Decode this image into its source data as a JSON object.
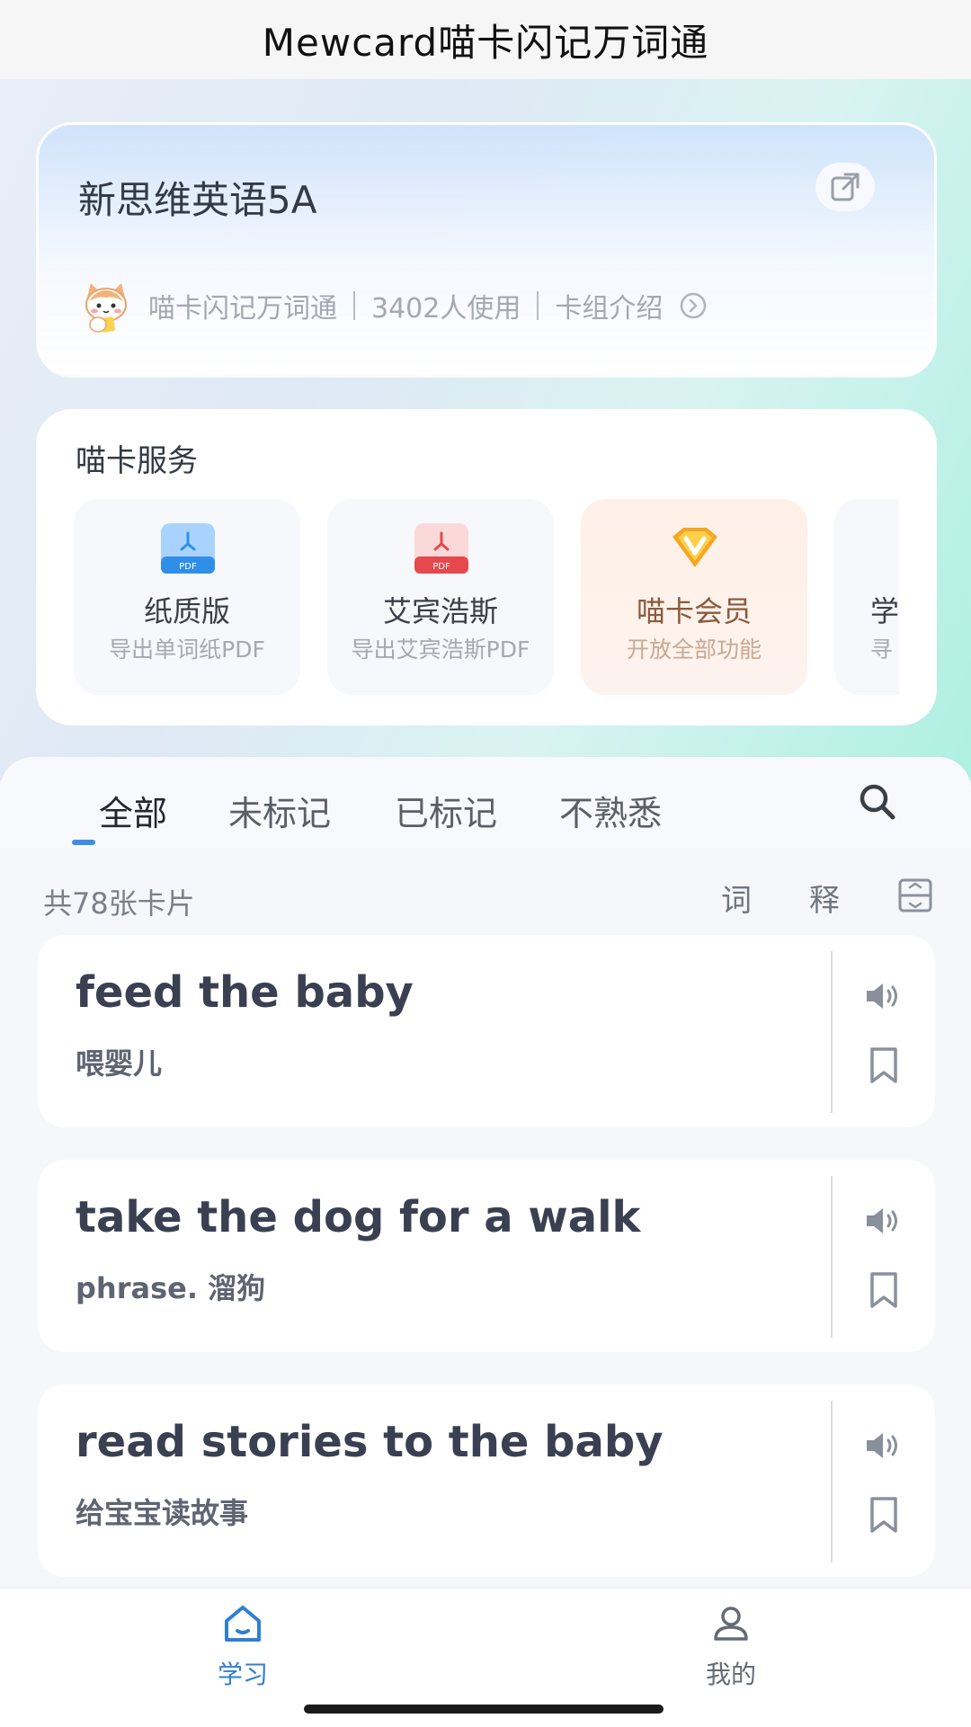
{
  "app_title": "Mewcard喵卡闪记万词通",
  "deck": {
    "title": "新思维英语5A",
    "source": "喵卡闪记万词通",
    "users": "3402人使用",
    "intro": "卡组介绍"
  },
  "services": {
    "title": "喵卡服务",
    "items": [
      {
        "title": "纸质版",
        "subtitle": "导出单词纸PDF",
        "icon": "pdf-blue-icon"
      },
      {
        "title": "艾宾浩斯",
        "subtitle": "导出艾宾浩斯PDF",
        "icon": "pdf-red-icon"
      },
      {
        "title": "喵卡会员",
        "subtitle": "开放全部功能",
        "icon": "vip-icon"
      },
      {
        "title": "学",
        "subtitle": "寻"
      }
    ]
  },
  "tabs": [
    {
      "label": "全部",
      "active": true
    },
    {
      "label": "未标记",
      "active": false
    },
    {
      "label": "已标记",
      "active": false
    },
    {
      "label": "不熟悉",
      "active": false
    }
  ],
  "list": {
    "count": "共78张卡片",
    "view_word": "词",
    "view_meaning": "释",
    "cards": [
      {
        "term": "feed the baby",
        "definition": "喂婴儿"
      },
      {
        "term": "take the dog for a walk",
        "definition": "phrase. 溜狗"
      },
      {
        "term": "read stories to the baby",
        "definition": "给宝宝读故事"
      }
    ]
  },
  "nav": {
    "items": [
      {
        "label": "学习",
        "icon": "home-icon",
        "active": true
      },
      {
        "label": "我的",
        "icon": "user-icon",
        "active": false
      }
    ]
  },
  "colors": {
    "accent": "#3d8ee6",
    "nav_active": "#2f7fd6",
    "nav_inactive": "#666b73",
    "vip_gold": "#f5a623"
  }
}
